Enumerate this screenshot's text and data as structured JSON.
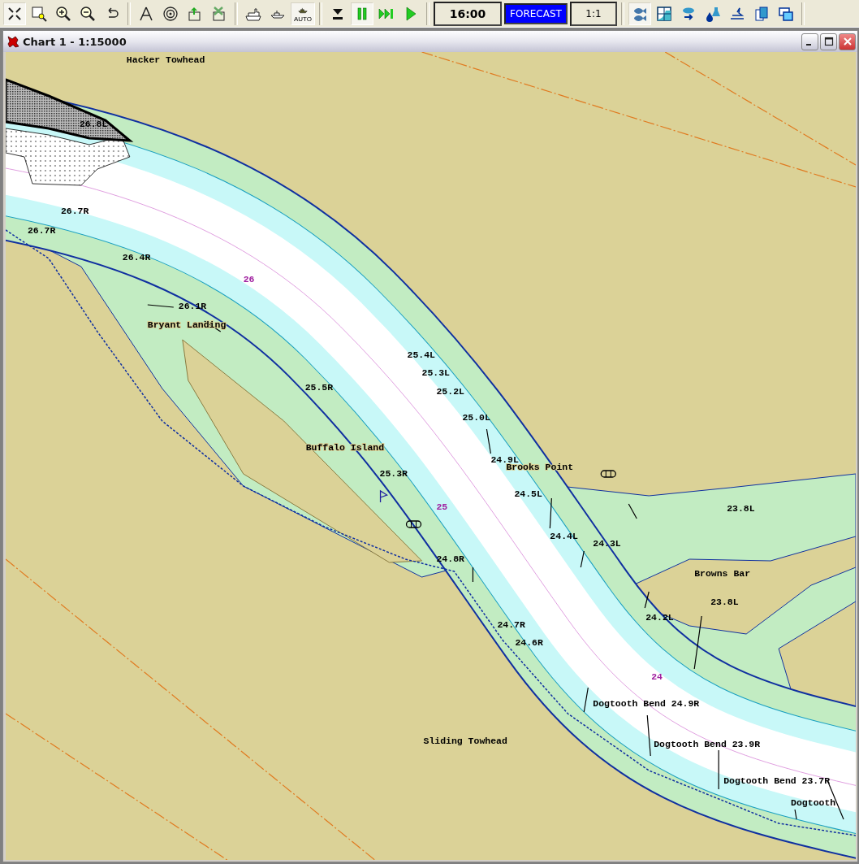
{
  "toolbar": {
    "groups": [
      [
        {
          "kind": "fit",
          "pressed": true
        },
        {
          "kind": "zoom-window",
          "pressed": false
        },
        {
          "kind": "zoom-in",
          "pressed": false
        },
        {
          "kind": "zoom-out",
          "pressed": false
        },
        {
          "kind": "undo",
          "pressed": false
        }
      ],
      [
        {
          "kind": "compass",
          "pressed": false
        },
        {
          "kind": "target",
          "pressed": false
        },
        {
          "kind": "export",
          "pressed": false
        },
        {
          "kind": "delete",
          "pressed": false
        }
      ],
      [
        {
          "kind": "ship-large",
          "pressed": false
        },
        {
          "kind": "ship-small",
          "pressed": false
        },
        {
          "kind": "ship-auto",
          "label": "AUTO",
          "pressed": true
        }
      ],
      [
        {
          "kind": "eject",
          "pressed": false
        },
        {
          "kind": "pause",
          "pressed": true
        },
        {
          "kind": "fast-forward",
          "pressed": false
        },
        {
          "kind": "play",
          "pressed": false
        }
      ]
    ],
    "time": "16:00",
    "mode": "FORECAST",
    "ratio": "1:1",
    "tools": [
      {
        "kind": "fish",
        "pressed": true
      },
      {
        "kind": "graph",
        "pressed": false
      },
      {
        "kind": "weather",
        "pressed": false
      },
      {
        "kind": "water",
        "pressed": false
      },
      {
        "kind": "tide",
        "pressed": false
      },
      {
        "kind": "documents",
        "pressed": false
      },
      {
        "kind": "windows",
        "pressed": false
      }
    ]
  },
  "window": {
    "title": "Chart 1 - 1:15000"
  },
  "chart": {
    "labels": [
      {
        "text": "Hacker Towhead",
        "kind": "place"
      },
      {
        "text": "26.8L",
        "kind": "mile"
      },
      {
        "text": "26.7R",
        "kind": "mile"
      },
      {
        "text": "26.7R",
        "kind": "mile"
      },
      {
        "text": "26.4R",
        "kind": "mile"
      },
      {
        "text": "26",
        "kind": "channel"
      },
      {
        "text": "26.1R",
        "kind": "mile"
      },
      {
        "text": "Bryant Landing",
        "kind": "place"
      },
      {
        "text": "25.4L",
        "kind": "mile"
      },
      {
        "text": "25.3L",
        "kind": "mile"
      },
      {
        "text": "25.2L",
        "kind": "mile"
      },
      {
        "text": "25.5R",
        "kind": "mile"
      },
      {
        "text": "25.0L",
        "kind": "mile"
      },
      {
        "text": "Buffalo Island",
        "kind": "place"
      },
      {
        "text": "24.9L",
        "kind": "mile"
      },
      {
        "text": "Brooks Point",
        "kind": "place"
      },
      {
        "text": "25.3R",
        "kind": "mile"
      },
      {
        "text": "24.5L",
        "kind": "mile"
      },
      {
        "text": "25",
        "kind": "channel"
      },
      {
        "text": "23.8L",
        "kind": "mile"
      },
      {
        "text": "24.4L",
        "kind": "mile"
      },
      {
        "text": "24.3L",
        "kind": "mile"
      },
      {
        "text": "24.8R",
        "kind": "mile"
      },
      {
        "text": "Browns Bar",
        "kind": "place"
      },
      {
        "text": "23.8L",
        "kind": "mile"
      },
      {
        "text": "24.2L",
        "kind": "mile"
      },
      {
        "text": "24.7R",
        "kind": "mile"
      },
      {
        "text": "24.6R",
        "kind": "mile"
      },
      {
        "text": "24",
        "kind": "channel"
      },
      {
        "text": "Dogtooth Bend 24.9R",
        "kind": "mile"
      },
      {
        "text": "Sliding Towhead",
        "kind": "place"
      },
      {
        "text": "Dogtooth Bend 23.9R",
        "kind": "mile"
      },
      {
        "text": "Dogtooth Bend 23.7R",
        "kind": "mile"
      },
      {
        "text": "Dogtooth",
        "kind": "mile"
      }
    ]
  }
}
